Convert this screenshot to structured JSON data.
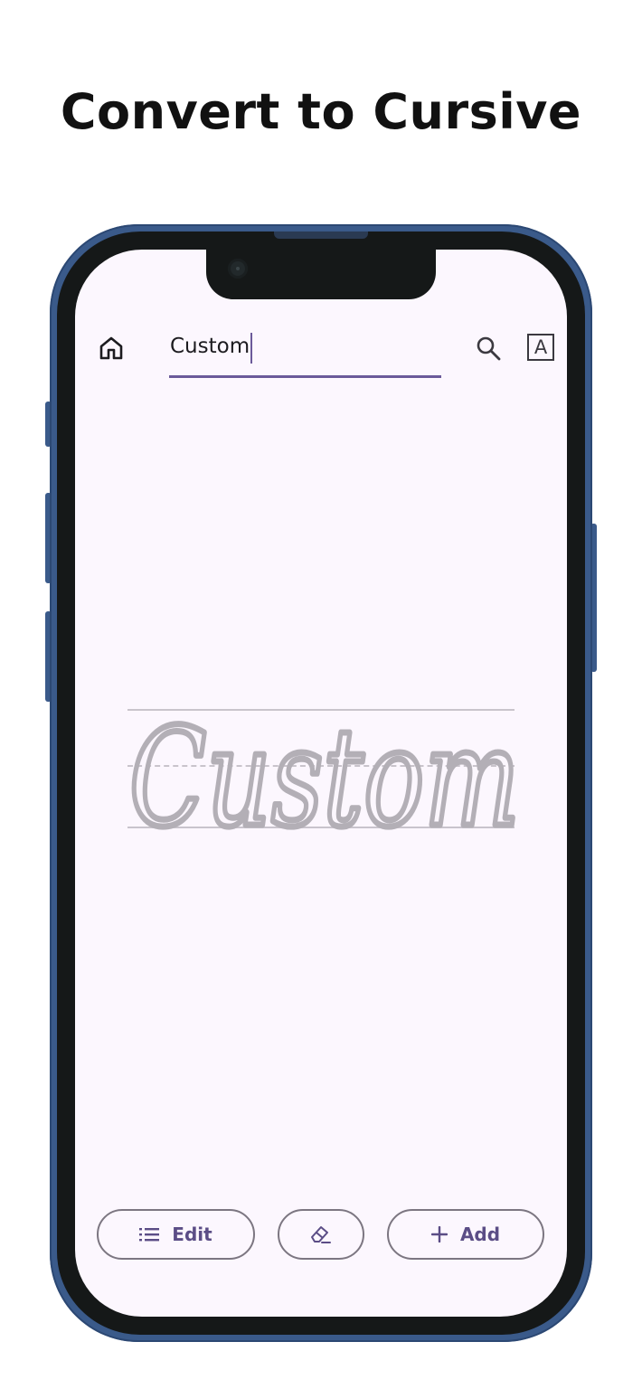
{
  "header": {
    "title": "Convert to Cursive"
  },
  "toolbar": {
    "input_value": "Custom",
    "font_button_label": "A"
  },
  "canvas": {
    "cursive_text": "Custom"
  },
  "actions": {
    "edit_label": "Edit",
    "add_label": "Add"
  },
  "icons": {
    "home": "home-icon",
    "search": "search-icon",
    "font": "font-icon",
    "list": "list-icon",
    "eraser": "eraser-icon",
    "plus": "plus-icon"
  },
  "colors": {
    "accent": "#6b5a9a",
    "phone_frame": "#3a5a8a",
    "screen_background": "#fcf7fe",
    "tracing_text": "#b3afb6"
  }
}
